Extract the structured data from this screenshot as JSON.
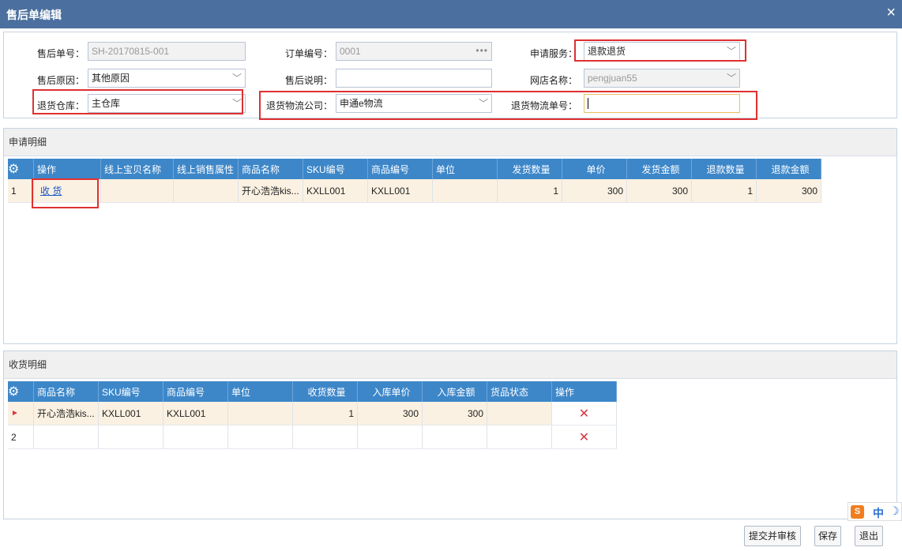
{
  "window": {
    "title": "售后单编辑",
    "close_icon": "×"
  },
  "form": {
    "aftersale_no": {
      "label": "售后单号：",
      "value": "SH-20170815-001"
    },
    "order_no": {
      "label": "订单编号：",
      "value": "0001"
    },
    "service": {
      "label": "申请服务：",
      "value": "退款退货"
    },
    "reason": {
      "label": "售后原因：",
      "value": "其他原因"
    },
    "desc": {
      "label": "售后说明：",
      "value": ""
    },
    "shop": {
      "label": "网店名称：",
      "value": "pengjuan55"
    },
    "warehouse": {
      "label": "退货仓库：",
      "value": "主仓库"
    },
    "logistics_company": {
      "label": "退货物流公司：",
      "value": "申通e物流"
    },
    "logistics_no": {
      "label": "退货物流单号：",
      "value": ""
    }
  },
  "apply_detail": {
    "title": "申请明细",
    "columns": [
      "操作",
      "线上宝贝名称",
      "线上销售属性",
      "商品名称",
      "SKU编号",
      "商品编号",
      "单位",
      "发货数量",
      "单价",
      "发货金额",
      "退款数量",
      "退款金额"
    ],
    "rows": [
      {
        "rownum": "1",
        "action": "收 货",
        "online_name": "",
        "online_attr": "",
        "product_name": "开心浩浩kis...",
        "sku": "KXLL001",
        "product_no": "KXLL001",
        "unit": "",
        "ship_qty": "1",
        "price": "300",
        "ship_amount": "300",
        "refund_qty": "1",
        "refund_amount": "300"
      }
    ]
  },
  "receive_detail": {
    "title": "收货明细",
    "columns": [
      "商品名称",
      "SKU编号",
      "商品编号",
      "单位",
      "收货数量",
      "入库单价",
      "入库金额",
      "货品状态",
      "操作"
    ],
    "rows": [
      {
        "rownum": "►",
        "product_name": "开心浩浩kis...",
        "sku": "KXLL001",
        "product_no": "KXLL001",
        "unit": "",
        "qty": "1",
        "price": "300",
        "amount": "300",
        "status": "",
        "delete": "✕"
      },
      {
        "rownum": "2",
        "product_name": "",
        "sku": "",
        "product_no": "",
        "unit": "",
        "qty": "",
        "price": "",
        "amount": "",
        "status": "",
        "delete": "✕"
      }
    ]
  },
  "buttons": {
    "submit_audit": "提交并审核",
    "save": "保存",
    "exit": "退出"
  },
  "ime": {
    "logo": "S",
    "lang": "中",
    "mode": "☽"
  },
  "colors": {
    "titlebar": "#4b6f9e",
    "grid_header": "#3d87c9",
    "highlight_row": "#fbf1e2",
    "annotation_red": "#e03030"
  }
}
